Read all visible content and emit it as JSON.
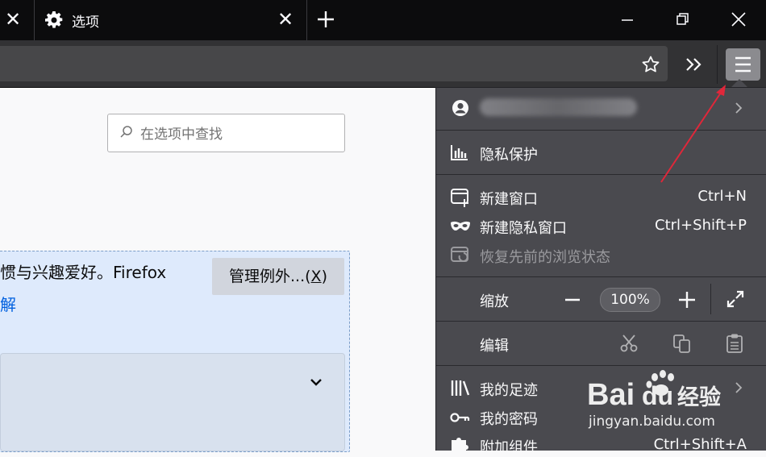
{
  "tab": {
    "title": "选项"
  },
  "content": {
    "search_placeholder": "在选项中查找",
    "info_text": "惯与兴趣爱好。Firefox",
    "info_link": "解",
    "manage_button": "管理例外...(X)",
    "manage_underline": "X"
  },
  "menu": {
    "account_email": "",
    "items": [
      {
        "label": "隐私保护",
        "shortcut": "",
        "icon": "privacy-chart-icon"
      },
      {
        "label": "新建窗口",
        "shortcut": "Ctrl+N",
        "icon": "new-window-icon"
      },
      {
        "label": "新建隐私窗口",
        "shortcut": "Ctrl+Shift+P",
        "icon": "private-mask-icon"
      },
      {
        "label": "恢复先前的浏览状态",
        "shortcut": "",
        "icon": "restore-session-icon",
        "disabled": true
      },
      {
        "label": "缩放",
        "shortcut": "",
        "icon": ""
      },
      {
        "label": "编辑",
        "shortcut": "",
        "icon": ""
      },
      {
        "label": "我的足迹",
        "shortcut": "",
        "icon": "library-icon"
      },
      {
        "label": "我的密码",
        "shortcut": "",
        "icon": "key-icon"
      },
      {
        "label": "附加组件",
        "shortcut": "Ctrl+Shift+A",
        "icon": "puzzle-icon"
      }
    ],
    "zoom_value": "100%"
  },
  "watermark": {
    "brand": "Bai du 经验",
    "url": "jingyan.baidu.com"
  },
  "colors": {
    "panel_bg": "#4a4a4f",
    "menu_button_bg": "#8b8b8f",
    "annotation_arrow": "#e0273a"
  }
}
